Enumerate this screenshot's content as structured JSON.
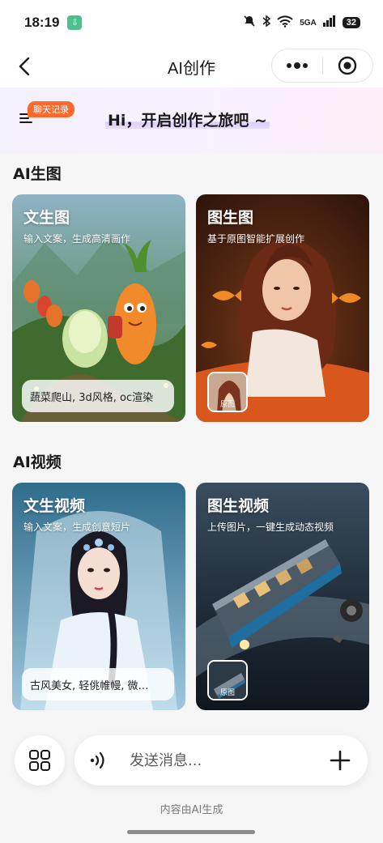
{
  "status_bar": {
    "time": "18:19",
    "network": "5GA",
    "battery": "32"
  },
  "nav": {
    "title": "AI创作"
  },
  "hero": {
    "history_tag": "聊天记录",
    "greeting": "Hi，开启创作之旅吧 ~"
  },
  "sections": {
    "image": {
      "title": "AI生图",
      "cards": [
        {
          "title": "文生图",
          "subtitle": "输入文案，生成高清画作",
          "prompt": "蔬菜爬山, 3d风格, oc渲染"
        },
        {
          "title": "图生图",
          "subtitle": "基于原图智能扩展创作",
          "thumb_label": "原图"
        }
      ]
    },
    "video": {
      "title": "AI视频",
      "cards": [
        {
          "title": "文生视频",
          "subtitle": "输入文案，生成创意短片",
          "prompt": "古风美女, 轻佻帷幔, 微…"
        },
        {
          "title": "图生视频",
          "subtitle": "上传图片，一键生成动态视频",
          "thumb_label": "原图"
        }
      ]
    }
  },
  "composer": {
    "placeholder": "发送消息..."
  },
  "footer_note": "内容由AI生成",
  "colors": {
    "accent_tag": "#ff6a2c",
    "page_bg": "#f6f6f7"
  }
}
